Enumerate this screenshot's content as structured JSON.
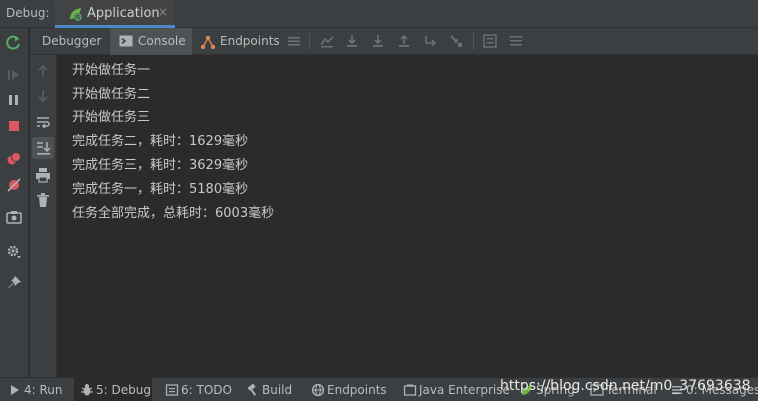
{
  "titlebar": {
    "label": "Debug:",
    "tab_label": "Application",
    "close_glyph": "×"
  },
  "tabs": {
    "debugger": "Debugger",
    "console": "Console",
    "endpoints": "Endpoints"
  },
  "console_lines": [
    "开始做任务一",
    "开始做任务二",
    "开始做任务三",
    "完成任务二，耗时：1629毫秒",
    "完成任务三，耗时：3629毫秒",
    "完成任务一，耗时：5180毫秒",
    "任务全部完成，总耗时：6003毫秒"
  ],
  "bottom_tools": {
    "run": "4: Run",
    "debug": "5: Debug",
    "todo": "6: TODO",
    "build": "Build",
    "endpoints": "Endpoints",
    "java_enterprise": "Java Enterprise",
    "spring": "Spring",
    "terminal": "Terminal",
    "messages": "0: Messages"
  },
  "watermark": "https://blog.csdn.net/m0_37693638",
  "colors": {
    "accent": "#4a88c7",
    "run_green": "#59a869",
    "stop_red": "#db5860"
  }
}
